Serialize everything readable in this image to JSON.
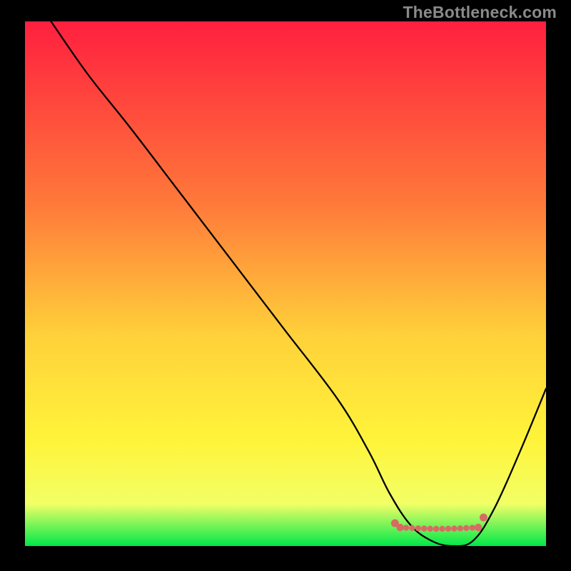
{
  "watermark": "TheBottleneck.com",
  "colors": {
    "frame": "#000000",
    "top": "#ff1f3f",
    "mid_upper": "#ff7a3a",
    "mid": "#ffd13a",
    "mid_lower": "#fff43a",
    "lower": "#f2ff66",
    "bottom": "#00e84a",
    "curve": "#000000",
    "markers": "#d86a64"
  },
  "chart_data": {
    "type": "line",
    "title": "",
    "xlabel": "",
    "ylabel": "",
    "xlim": [
      0,
      100
    ],
    "ylim": [
      0,
      100
    ],
    "series": [
      {
        "name": "bottleneck-curve",
        "x": [
          5,
          12,
          20,
          30,
          40,
          50,
          60,
          66,
          70,
          74,
          78,
          82,
          86,
          90,
          95,
          100
        ],
        "y": [
          100,
          90,
          80,
          67,
          54,
          41,
          28,
          18,
          10,
          4,
          1,
          0,
          1,
          7,
          18,
          30
        ]
      }
    ],
    "markers": {
      "name": "optimal-range",
      "x_range": [
        72,
        87
      ],
      "y": 0
    },
    "gradient_stops": [
      {
        "pct": 0,
        "meaning": "severe-bottleneck",
        "color": "top"
      },
      {
        "pct": 35,
        "meaning": "high-bottleneck",
        "color": "mid_upper"
      },
      {
        "pct": 60,
        "meaning": "moderate",
        "color": "mid"
      },
      {
        "pct": 80,
        "meaning": "low",
        "color": "mid_lower"
      },
      {
        "pct": 92,
        "meaning": "minimal",
        "color": "lower"
      },
      {
        "pct": 100,
        "meaning": "no-bottleneck",
        "color": "bottom"
      }
    ]
  }
}
